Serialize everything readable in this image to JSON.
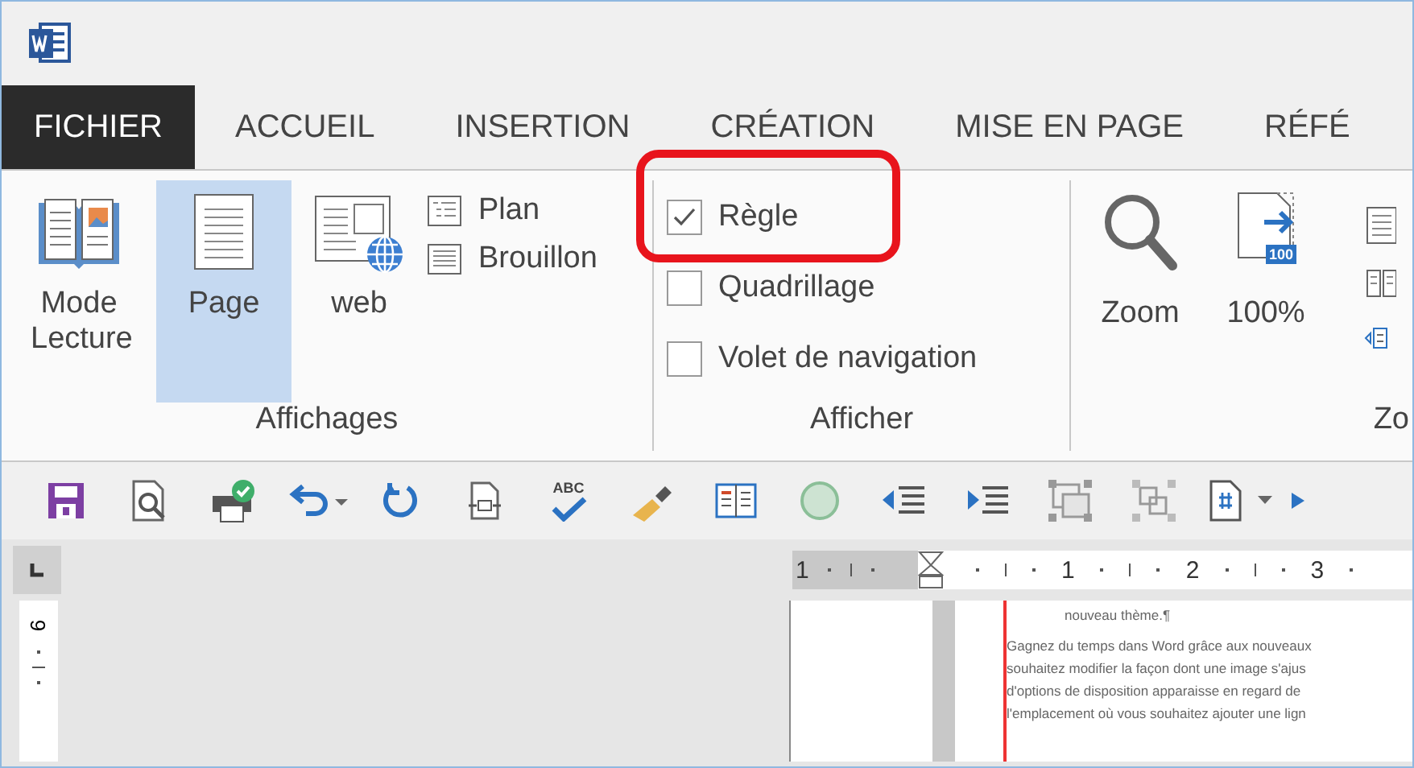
{
  "tabs": [
    {
      "label": "FICHIER",
      "kind": "file",
      "selected": false
    },
    {
      "label": "ACCUEIL",
      "kind": "tab",
      "selected": false
    },
    {
      "label": "INSERTION",
      "kind": "tab",
      "selected": false
    },
    {
      "label": "CRÉATION",
      "kind": "tab",
      "selected": false
    },
    {
      "label": "MISE EN PAGE",
      "kind": "tab",
      "selected": false
    },
    {
      "label": "RÉFÉ",
      "kind": "tab",
      "selected": false
    }
  ],
  "ribbon": {
    "affichages": {
      "label": "Affichages",
      "large_buttons": [
        {
          "label": "Mode Lecture",
          "kind": "read",
          "selected": false
        },
        {
          "label": "Page",
          "kind": "page",
          "selected": true
        },
        {
          "label": "web",
          "kind": "web",
          "selected": false
        }
      ],
      "small_buttons": [
        {
          "label": "Plan",
          "kind": "outline"
        },
        {
          "label": "Brouillon",
          "kind": "draft"
        }
      ]
    },
    "afficher": {
      "label": "Afficher",
      "checkboxes": [
        {
          "label": "Règle",
          "checked": true
        },
        {
          "label": "Quadrillage",
          "checked": false
        },
        {
          "label": "Volet de navigation",
          "checked": false
        }
      ]
    },
    "zoom": {
      "label": "Zo",
      "buttons": [
        {
          "label": "Zoom",
          "kind": "zoom"
        },
        {
          "label": "100%",
          "kind": "hundred",
          "badge": "100"
        }
      ]
    }
  },
  "quick_access": {
    "spelling_label": "ABC"
  },
  "ruler": {
    "numbers": [
      "1",
      "1",
      "2",
      "3"
    ],
    "vertical_number": "9"
  },
  "document": {
    "lines": [
      "nouveau thème.¶",
      "Gagnez du temps dans Word grâce aux nouveaux",
      "souhaitez modifier la façon dont une image s'ajus",
      "d'options de disposition apparaisse en regard de",
      "l'emplacement où vous souhaitez ajouter une lign"
    ]
  }
}
